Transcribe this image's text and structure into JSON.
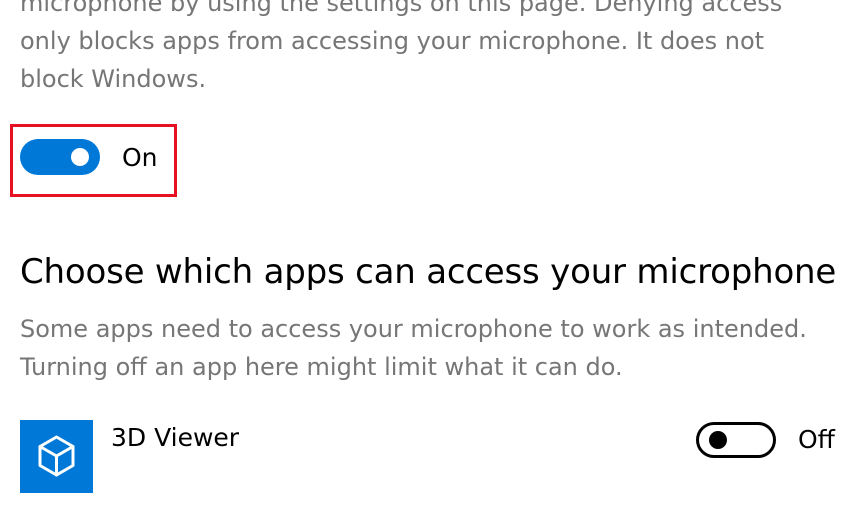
{
  "intro": {
    "line1": "microphone by using the settings on this page. Denying access",
    "line2": "only blocks apps from accessing your microphone. It does not",
    "line3": "block Windows."
  },
  "main_toggle": {
    "state": "on",
    "label": "On",
    "accent_color": "#0078d7",
    "highlight_color": "#e81123"
  },
  "section": {
    "title": "Choose which apps can access your microphone",
    "desc_line1": "Some apps need to access your microphone to work as intended.",
    "desc_line2": "Turning off an app here might limit what it can do."
  },
  "apps": [
    {
      "name": "3D Viewer",
      "icon": "3d-cube-icon",
      "toggle_state": "off",
      "toggle_label": "Off"
    }
  ]
}
